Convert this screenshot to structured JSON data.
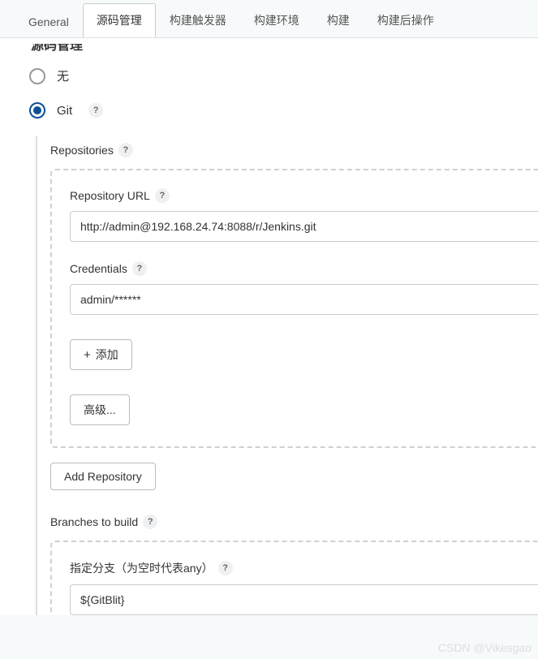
{
  "tabs": {
    "general": "General",
    "scm": "源码管理",
    "triggers": "构建触发器",
    "env": "构建环境",
    "build": "构建",
    "post": "构建后操作"
  },
  "section_header": "源码管理",
  "scm_options": {
    "none": "无",
    "git": "Git"
  },
  "repositories": {
    "label": "Repositories",
    "url_label": "Repository URL",
    "url_value": "http://admin@192.168.24.74:8088/r/Jenkins.git",
    "credentials_label": "Credentials",
    "credentials_value": "admin/******",
    "add_label": "添加",
    "advanced_label": "高级...",
    "add_repo_label": "Add Repository"
  },
  "branches": {
    "label": "Branches to build",
    "spec_label": "指定分支（为空时代表any）",
    "spec_value": "${GitBlit}"
  },
  "help_char": "?",
  "plus_char": "+",
  "watermark": "CSDN @Vikesgao"
}
